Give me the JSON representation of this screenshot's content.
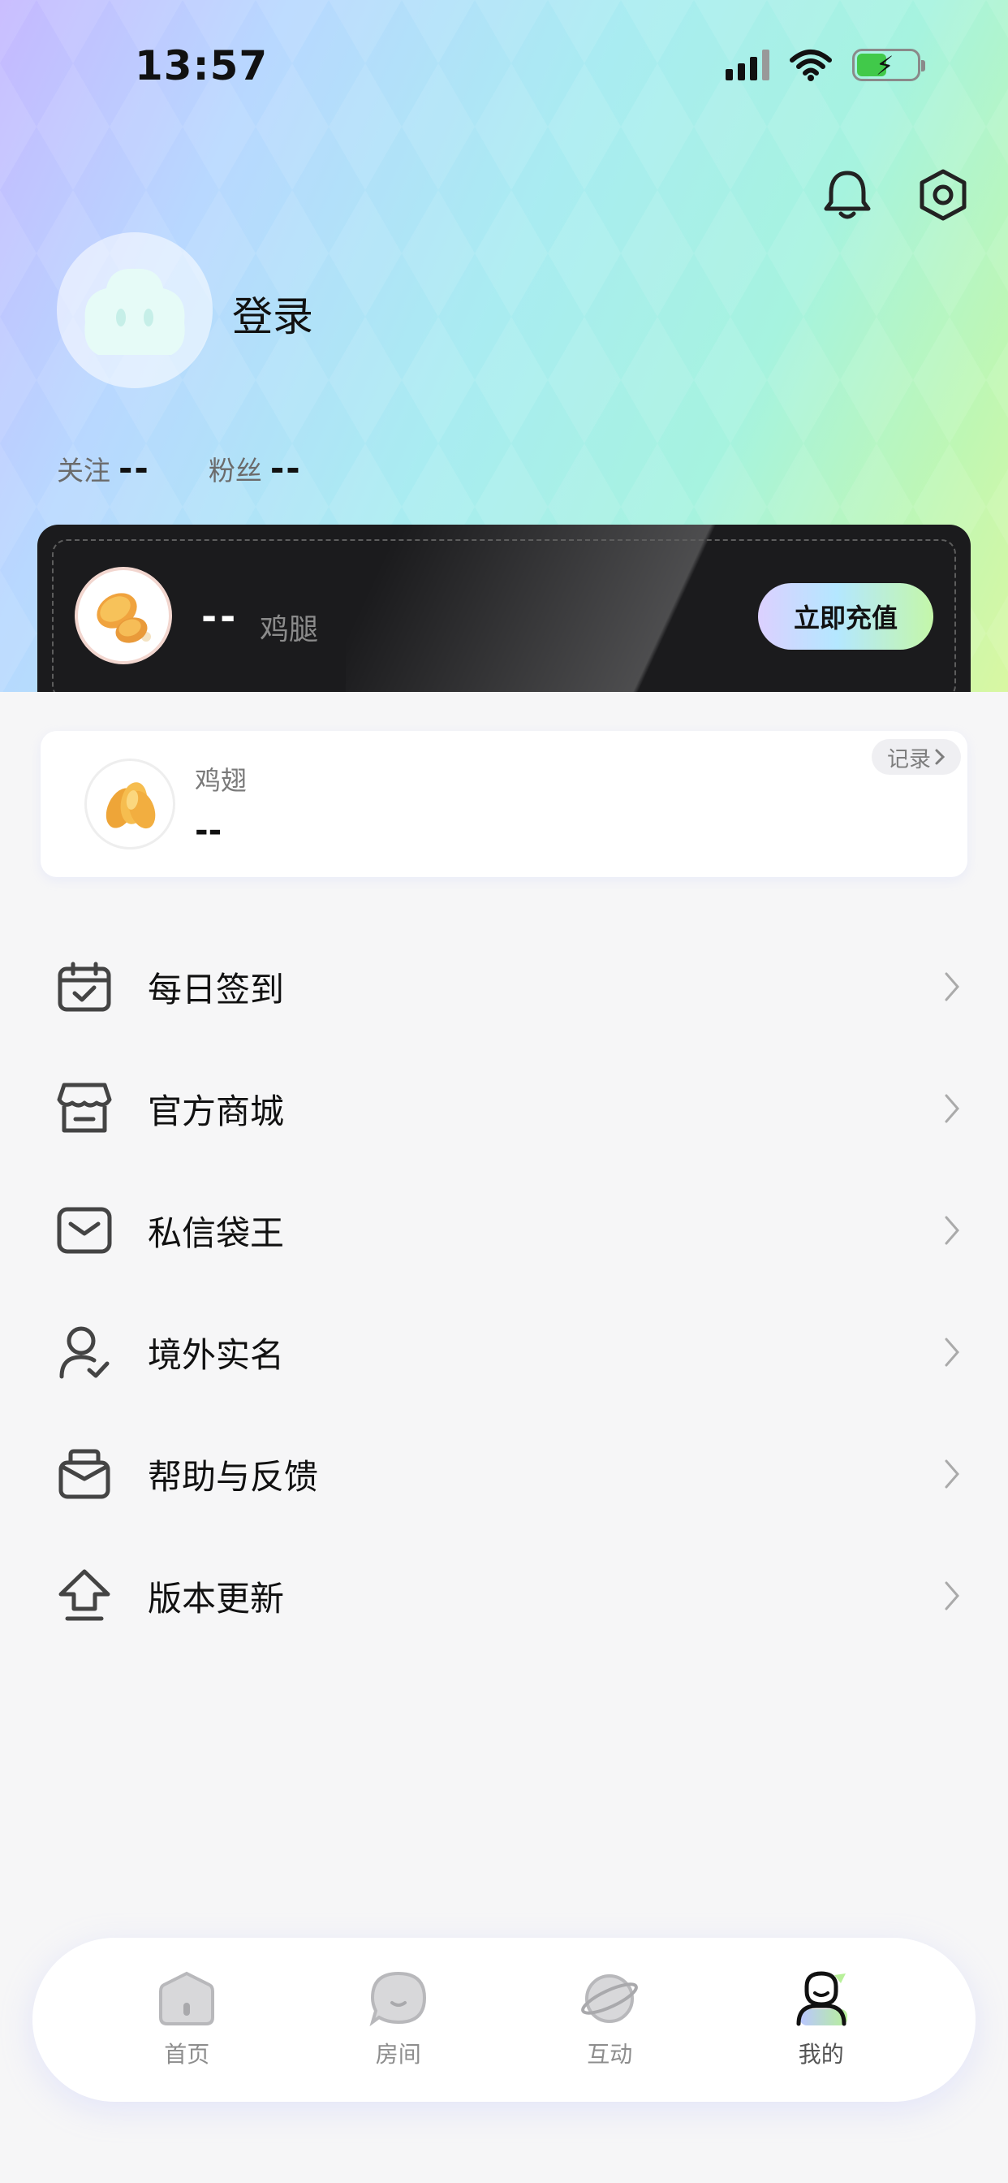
{
  "status_bar": {
    "time": "13:57"
  },
  "header": {
    "login_label": "登录",
    "follow_label": "关注",
    "follow_value": "--",
    "fans_label": "粉丝",
    "fans_value": "--"
  },
  "balance": {
    "value": "--",
    "currency_label": "鸡腿",
    "recharge_label": "立即充值"
  },
  "wings": {
    "label": "鸡翅",
    "value": "--",
    "record_label": "记录"
  },
  "menu": {
    "items": [
      {
        "label": "每日签到",
        "icon": "calendar-check-icon"
      },
      {
        "label": "官方商城",
        "icon": "store-icon"
      },
      {
        "label": "私信袋王",
        "icon": "mail-icon"
      },
      {
        "label": "境外实名",
        "icon": "user-verify-icon"
      },
      {
        "label": "帮助与反馈",
        "icon": "feedback-icon"
      },
      {
        "label": "版本更新",
        "icon": "upgrade-icon"
      }
    ]
  },
  "tabbar": {
    "tabs": [
      {
        "label": "首页",
        "icon": "home-icon"
      },
      {
        "label": "房间",
        "icon": "room-icon"
      },
      {
        "label": "互动",
        "icon": "planet-icon"
      },
      {
        "label": "我的",
        "icon": "profile-icon",
        "active": true
      }
    ]
  },
  "colors": {
    "accent_green": "#b8f09a",
    "card_dark": "#1b1b1d",
    "text_secondary": "#7a7a7a"
  }
}
